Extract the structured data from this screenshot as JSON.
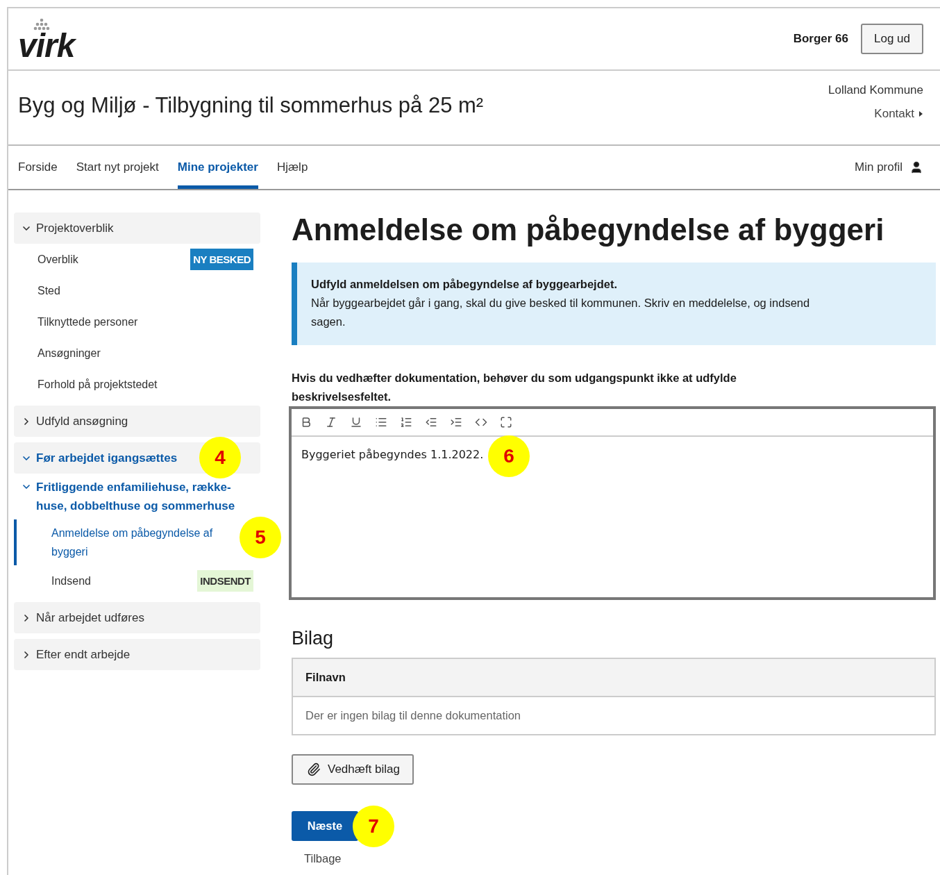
{
  "header": {
    "logo": "virk",
    "user": "Borger 66",
    "logout": "Log ud"
  },
  "title_bar": {
    "title": "Byg og Miljø - Tilbygning til sommerhus på 25 m²",
    "municipality": "Lolland Kommune",
    "contact": "Kontakt"
  },
  "nav": {
    "tabs": [
      {
        "label": "Forside",
        "selected": false
      },
      {
        "label": "Start nyt projekt",
        "selected": false
      },
      {
        "label": "Mine projekter",
        "selected": true
      },
      {
        "label": "Hjælp",
        "selected": false
      }
    ],
    "profile": "Min profil"
  },
  "sidebar": {
    "groups": [
      {
        "label": "Projektoverblik",
        "expanded": true,
        "current": false,
        "children": [
          {
            "label": "Overblik",
            "selected": false,
            "badge": {
              "text": "NY BESKED",
              "kind": "info"
            }
          },
          {
            "label": "Sted",
            "selected": false
          },
          {
            "label": "Tilknyttede personer",
            "selected": false
          },
          {
            "label": "Ansøgninger",
            "selected": false
          },
          {
            "label": "Forhold på projektstedet",
            "selected": false
          }
        ]
      },
      {
        "label": "Udfyld ansøgning",
        "expanded": false,
        "current": false
      },
      {
        "label": "Før arbejdet igangsættes",
        "expanded": true,
        "current": true,
        "callout": "4",
        "subgroups": [
          {
            "label": "Fritliggende enfamiliehuse, række-huse, dobbelthuse og sommerhuse",
            "expanded": true,
            "children": [
              {
                "label": "Anmeldelse om påbegyndelse af byggeri",
                "selected": true,
                "callout": "5"
              },
              {
                "label": "Indsend",
                "selected": false,
                "badge": {
                  "text": "INDSENDT",
                  "kind": "success"
                }
              }
            ]
          }
        ]
      },
      {
        "label": "Når arbejdet udføres",
        "expanded": false,
        "current": false
      },
      {
        "label": "Efter endt arbejde",
        "expanded": false,
        "current": false
      }
    ]
  },
  "main": {
    "heading": "Anmeldelse om påbegyndelse af byggeri",
    "info": {
      "title": "Udfyld anmeldelsen om påbegyndelse af byggearbejdet.",
      "text": "Når byggearbejdet går i gang, skal du give besked til kommunen. Skriv en meddelelse, og indsend sagen."
    },
    "editor": {
      "label": "Hvis du vedhæfter dokumentation, behøver du som udgangspunkt ikke at udfylde beskrivelsesfeltet.",
      "value": "Byggeriet påbegyndes 1.1.2022.",
      "callout": "6"
    },
    "attachments": {
      "heading": "Bilag",
      "column": "Filnavn",
      "empty": "Der er ingen bilag til denne dokumentation",
      "button": "Vedhæft bilag"
    },
    "next": {
      "label": "Næste",
      "callout": "7"
    },
    "back": "Tilbage"
  }
}
